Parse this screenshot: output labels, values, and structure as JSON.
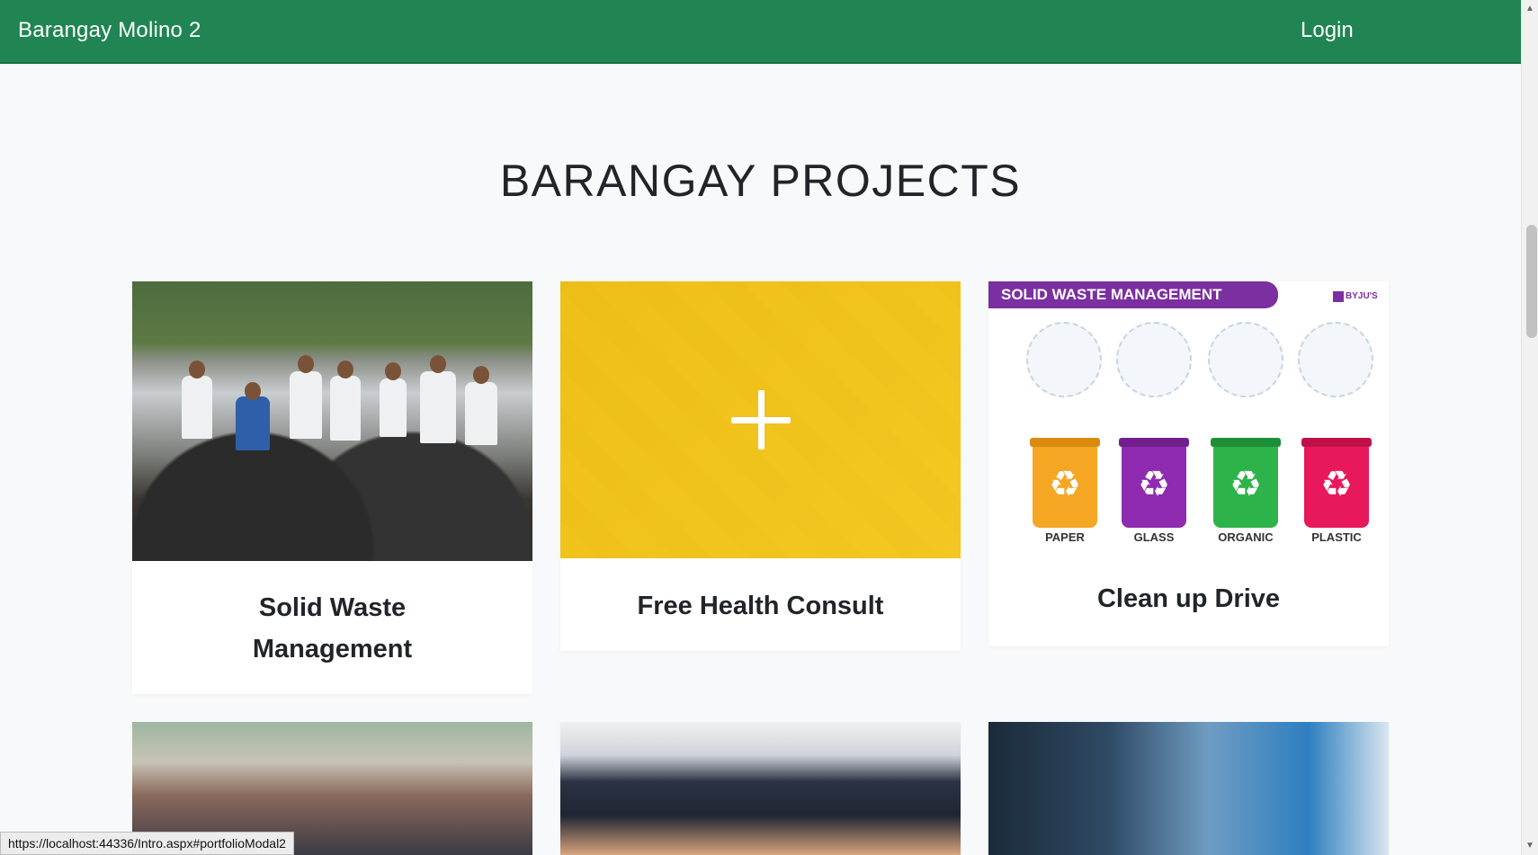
{
  "navbar": {
    "brand": "Barangay Molino 2",
    "login": "Login",
    "color": "#208552"
  },
  "section": {
    "title": "BARANGAY PROJECTS"
  },
  "cards": [
    {
      "caption": "Solid Waste Management",
      "image": "cleanup-volunteers-photo"
    },
    {
      "caption": "Free Health Consult",
      "image": "health-consult-photo-yellow-overlay"
    },
    {
      "caption": "Clean up Drive",
      "image": "solid-waste-infographic"
    }
  ],
  "infographic": {
    "banner": "SOLID WASTE MANAGEMENT",
    "logo": "BYJU'S",
    "bins": [
      {
        "label": "PAPER",
        "color": "#f5a623"
      },
      {
        "label": "GLASS",
        "color": "#8e2bb0"
      },
      {
        "label": "ORGANIC",
        "color": "#2db34a"
      },
      {
        "label": "PLASTIC",
        "color": "#e8185c"
      }
    ]
  },
  "status_url": "https://localhost:44336/Intro.aspx#portfolioModal2",
  "icons": {
    "plus": "plus-icon",
    "recycle": "recycle-icon"
  }
}
